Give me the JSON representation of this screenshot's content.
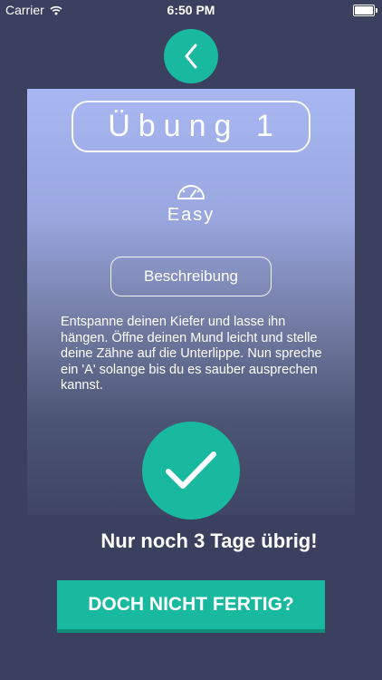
{
  "status_bar": {
    "carrier": "Carrier",
    "time": "6:50 PM"
  },
  "exercise": {
    "title": "Übung 1",
    "difficulty": "Easy",
    "description_button": "Beschreibung",
    "description": "Entspanne deinen Kiefer und lasse ihn hängen. Öffne deinen Mund leicht und stelle deine Zähne auf die Unterlippe. Nun spreche ein 'A' solange bis du es sauber ausprechen kannst."
  },
  "remaining_text": "Nur noch 3 Tage übrig!",
  "undo_button": "DOCH NICHT FERTIG?",
  "colors": {
    "background": "#3a405e",
    "accent": "#18b99f"
  },
  "icons": {
    "back": "chevron-left-icon",
    "gauge": "speedometer-icon",
    "check": "checkmark-icon",
    "wifi": "wifi-icon",
    "battery": "battery-icon"
  }
}
